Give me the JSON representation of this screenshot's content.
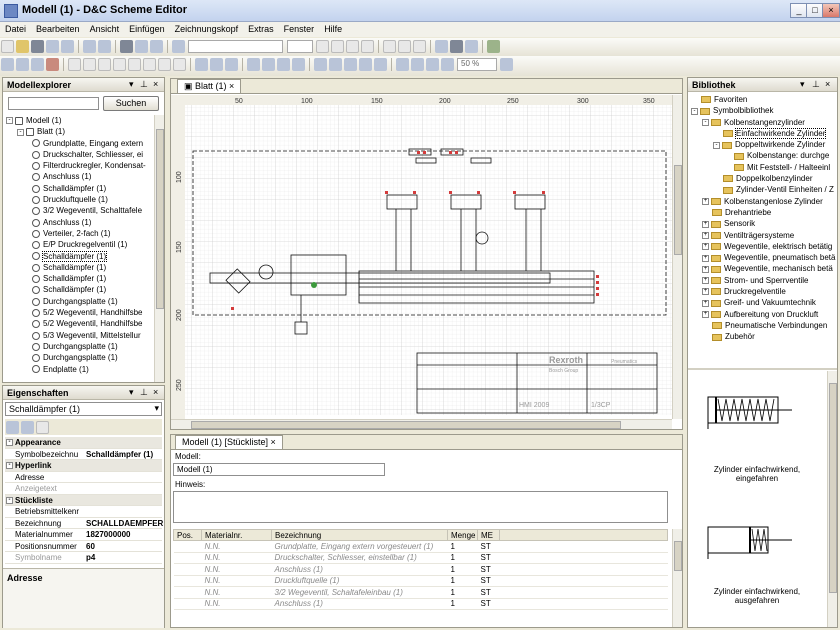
{
  "app": {
    "title": "Modell (1) - D&C Scheme Editor"
  },
  "menu": [
    "Datei",
    "Bearbeiten",
    "Ansicht",
    "Einfügen",
    "Zeichnungskopf",
    "Extras",
    "Fenster",
    "Hilfe"
  ],
  "toolbar": {
    "zoom": "50 %"
  },
  "explorer": {
    "title": "Modellexplorer",
    "search_button": "Suchen",
    "root": "Modell (1)",
    "sheet": "Blatt (1)",
    "items": [
      "Grundplatte, Eingang extern",
      "Druckschalter, Schliesser, ei",
      "Filterdruckregler, Kondensat-",
      "Anschluss (1)",
      "Schalldämpfer (1)",
      "Druckluftquelle (1)",
      "3/2 Wegeventil, Schalttafele",
      "Anschluss (1)",
      "Verteiler, 2-fach (1)",
      "E/P Druckregelventil (1)",
      "Schalldämpfer (1)",
      "Schalldämpfer (1)",
      "Schalldämpfer (1)",
      "Schalldämpfer (1)",
      "Durchgangsplatte (1)",
      "5/2 Wegeventil, Handhilfsbe",
      "5/2 Wegeventil, Handhilfsbe",
      "5/3 Wegeventil, Mittelstellur",
      "Durchgangsplatte (1)",
      "Durchgangsplatte (1)",
      "Endplatte (1)"
    ],
    "selected_index": 10
  },
  "properties": {
    "title": "Eigenschaften",
    "selected": "Schalldämpfer (1)",
    "rows": [
      {
        "type": "cat",
        "k": "Appearance"
      },
      {
        "k": "Symbolbezeichnu",
        "v": "Schalldämpfer (1)"
      },
      {
        "type": "cat",
        "k": "Hyperlink"
      },
      {
        "k": "Adresse",
        "v": ""
      },
      {
        "k": "Anzeigetext",
        "v": "",
        "grey": true
      },
      {
        "type": "cat",
        "k": "Stückliste"
      },
      {
        "k": "Betriebsmittelkenr",
        "v": ""
      },
      {
        "k": "Bezeichnung",
        "v": "SCHALLDAEMPFER"
      },
      {
        "k": "Materialnummer",
        "v": "1827000000"
      },
      {
        "k": "Positionsnummer",
        "v": "60"
      },
      {
        "k": "Symbolname",
        "v": "p4",
        "grey": true
      }
    ],
    "footer": "Adresse"
  },
  "canvas": {
    "tab": "Blatt (1)",
    "ruler_top": [
      "50",
      "100",
      "150",
      "200",
      "250",
      "300",
      "350"
    ],
    "ruler_left": [
      "100",
      "150",
      "200",
      "250"
    ],
    "logo": "Rexroth",
    "logo_sub": "Bosch Group",
    "titleblock_text": "Pneumatics",
    "title_code": "HMI 2009",
    "title_code2": "1/3CP"
  },
  "bom": {
    "tab": "Modell (1) [Stückliste]",
    "modell_label": "Modell:",
    "modell_value": "Modell (1)",
    "hint_label": "Hinweis:",
    "columns": [
      "Pos.",
      "Materialnr.",
      "Bezeichnung",
      "Menge",
      "ME"
    ],
    "rows": [
      {
        "pos": "",
        "mat": "N.N.",
        "bez": "Grundplatte, Eingang extern vorgesteuert (1)",
        "menge": "1",
        "me": "ST"
      },
      {
        "pos": "",
        "mat": "N.N.",
        "bez": "Druckschalter, Schliesser, einstellbar (1)",
        "menge": "1",
        "me": "ST"
      },
      {
        "pos": "",
        "mat": "N.N.",
        "bez": "Anschluss (1)",
        "menge": "1",
        "me": "ST"
      },
      {
        "pos": "",
        "mat": "N.N.",
        "bez": "Druckluftquelle (1)",
        "menge": "1",
        "me": "ST"
      },
      {
        "pos": "",
        "mat": "N.N.",
        "bez": "3/2 Wegeventil, Schaltafeleinbau (1)",
        "menge": "1",
        "me": "ST"
      },
      {
        "pos": "",
        "mat": "N.N.",
        "bez": "Anschluss (1)",
        "menge": "1",
        "me": "ST"
      }
    ]
  },
  "library": {
    "title": "Bibliothek",
    "items": [
      {
        "lvl": 0,
        "t": "Favoriten",
        "pm": ""
      },
      {
        "lvl": 0,
        "t": "Symbolbibliothek",
        "pm": "-"
      },
      {
        "lvl": 1,
        "t": "Kolbenstangenzylinder",
        "pm": "-"
      },
      {
        "lvl": 2,
        "t": "Einfachwirkende Zylinder",
        "pm": "",
        "sel": true
      },
      {
        "lvl": 2,
        "t": "Doppeltwirkende Zylinder",
        "pm": "-"
      },
      {
        "lvl": 3,
        "t": "Kolbenstange: durchge",
        "pm": ""
      },
      {
        "lvl": 3,
        "t": "Mit Feststell- / Halteeinl",
        "pm": ""
      },
      {
        "lvl": 2,
        "t": "Doppelkolbenzylinder",
        "pm": ""
      },
      {
        "lvl": 2,
        "t": "Zylinder-Ventil Einheiten / Z",
        "pm": ""
      },
      {
        "lvl": 1,
        "t": "Kolbenstangenlose Zylinder",
        "pm": "+"
      },
      {
        "lvl": 1,
        "t": "Drehantriebe",
        "pm": ""
      },
      {
        "lvl": 1,
        "t": "Sensorik",
        "pm": "+"
      },
      {
        "lvl": 1,
        "t": "Ventilträgersysteme",
        "pm": "+"
      },
      {
        "lvl": 1,
        "t": "Wegeventile, elektrisch betätig",
        "pm": "+"
      },
      {
        "lvl": 1,
        "t": "Wegeventile, pneumatisch betä",
        "pm": "+"
      },
      {
        "lvl": 1,
        "t": "Wegeventile, mechanisch betä",
        "pm": "+"
      },
      {
        "lvl": 1,
        "t": "Strom- und Sperrventile",
        "pm": "+"
      },
      {
        "lvl": 1,
        "t": "Druckregelventile",
        "pm": "+"
      },
      {
        "lvl": 1,
        "t": "Greif- und Vakuumtechnik",
        "pm": "+"
      },
      {
        "lvl": 1,
        "t": "Aufbereitung von Druckluft",
        "pm": "+"
      },
      {
        "lvl": 1,
        "t": "Pneumatische Verbindungen",
        "pm": ""
      },
      {
        "lvl": 1,
        "t": "Zubehör",
        "pm": ""
      }
    ],
    "preview": [
      {
        "caption1": "Zylinder einfachwirkend,",
        "caption2": "eingefahren"
      },
      {
        "caption1": "Zylinder einfachwirkend,",
        "caption2": "ausgefahren"
      }
    ]
  }
}
